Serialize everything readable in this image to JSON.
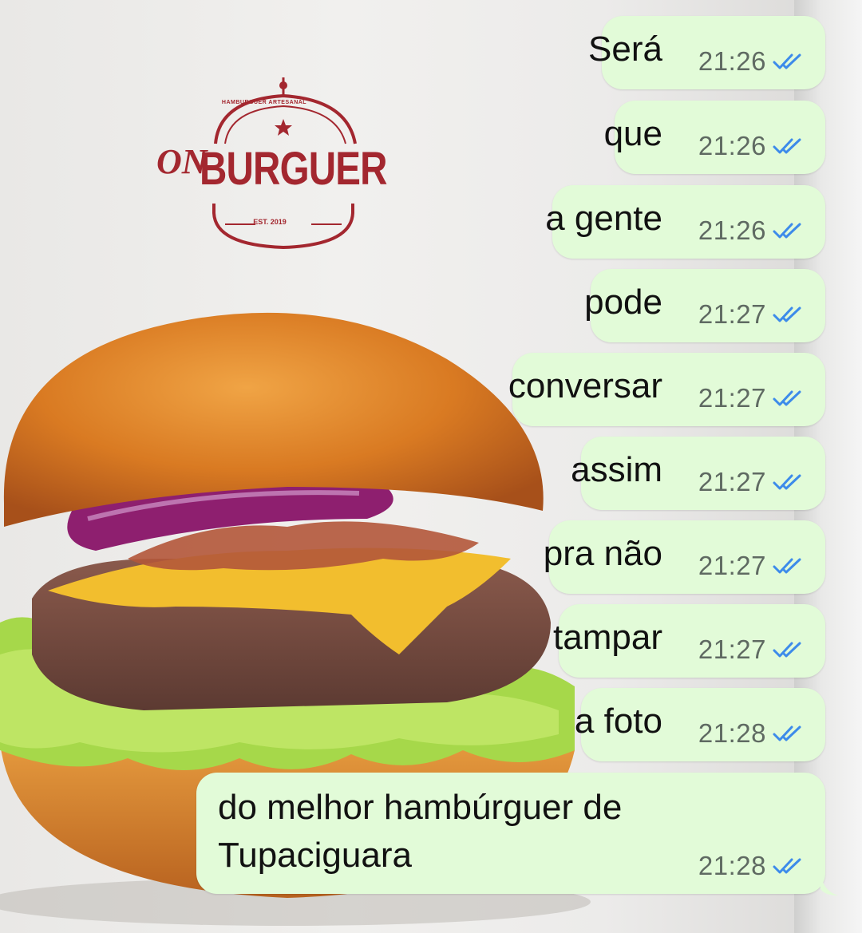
{
  "logo": {
    "prefix": "ON",
    "word": "BURGUER",
    "arc_text": "HAMBURGUER ARTESANAL",
    "est": "EST. 2019"
  },
  "colors": {
    "bubble": "#e2fbd8",
    "tick": "#3d8bea",
    "time": "#5f6a62",
    "brand": "#a3272f"
  },
  "messages": [
    {
      "text": "Será",
      "time": "21:26",
      "status": "read"
    },
    {
      "text": "que",
      "time": "21:26",
      "status": "read"
    },
    {
      "text": "a gente",
      "time": "21:26",
      "status": "read"
    },
    {
      "text": "pode",
      "time": "21:27",
      "status": "read"
    },
    {
      "text": "conversar",
      "time": "21:27",
      "status": "read"
    },
    {
      "text": "assim",
      "time": "21:27",
      "status": "read"
    },
    {
      "text": "pra não",
      "time": "21:27",
      "status": "read"
    },
    {
      "text": "tampar",
      "time": "21:27",
      "status": "read"
    },
    {
      "text": "a foto",
      "time": "21:28",
      "status": "read"
    },
    {
      "text": "do melhor hambúrguer de Tupaciguara",
      "time": "21:28",
      "status": "read"
    }
  ]
}
